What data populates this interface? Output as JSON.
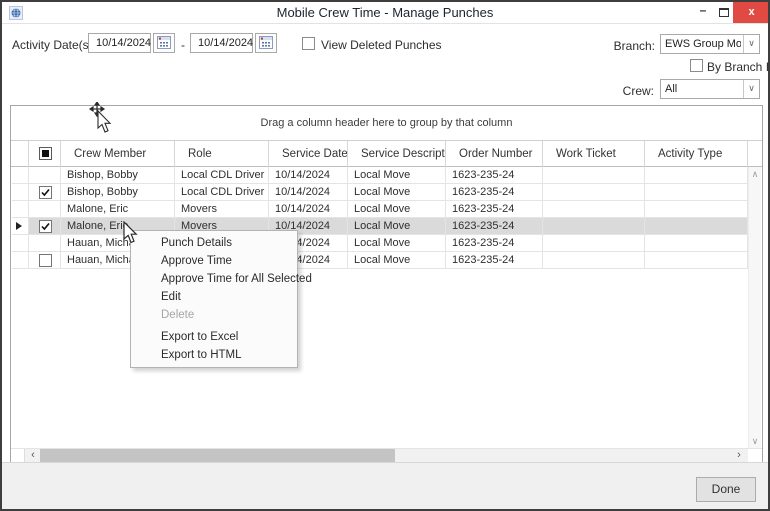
{
  "window": {
    "title": "Mobile Crew Time - Manage Punches",
    "minimize_glyph": "–",
    "close_glyph": "x"
  },
  "filters": {
    "activity_dates_label": "Activity Date(s):",
    "date_from": "10/14/2024",
    "date_range_separator": "-",
    "date_to": "10/14/2024",
    "view_deleted_label": "View Deleted Punches",
    "view_deleted_checked": false,
    "branch_label": "Branch:",
    "branch_value": "EWS Group Moving & Stor",
    "by_branch_id_label": "By Branch ID",
    "by_branch_id_checked": false,
    "crew_label": "Crew:",
    "crew_value": "All"
  },
  "grid": {
    "group_hint": "Drag a column header here to group by that column",
    "select_all_state": "indeterminate",
    "columns": [
      "Crew Member",
      "Role",
      "Service Date",
      "Service Description",
      "Order Number",
      "Work Ticket",
      "Activity Type"
    ],
    "rows": [
      {
        "checkbox": "none",
        "selected": false,
        "crew_member": "Bishop, Bobby",
        "role": "Local CDL Driver",
        "service_date": "10/14/2024",
        "service_description": "Local Move",
        "order_number": "1623-235-24",
        "work_ticket": "",
        "activity_type": ""
      },
      {
        "checkbox": "checked",
        "selected": false,
        "crew_member": "Bishop, Bobby",
        "role": "Local CDL Driver",
        "service_date": "10/14/2024",
        "service_description": "Local Move",
        "order_number": "1623-235-24",
        "work_ticket": "",
        "activity_type": ""
      },
      {
        "checkbox": "none",
        "selected": false,
        "crew_member": "Malone, Eric",
        "role": "Movers",
        "service_date": "10/14/2024",
        "service_description": "Local Move",
        "order_number": "1623-235-24",
        "work_ticket": "",
        "activity_type": ""
      },
      {
        "checkbox": "checked",
        "selected": true,
        "crew_member": "Malone, Eric",
        "role": "Movers",
        "service_date": "10/14/2024",
        "service_description": "Local Move",
        "order_number": "1623-235-24",
        "work_ticket": "",
        "activity_type": ""
      },
      {
        "checkbox": "none",
        "selected": false,
        "crew_member": "Hauan, Micha",
        "role": "",
        "service_date": "10/14/2024",
        "service_description": "Local Move",
        "order_number": "1623-235-24",
        "work_ticket": "",
        "activity_type": ""
      },
      {
        "checkbox": "unchecked",
        "selected": false,
        "crew_member": "Hauan, Micha",
        "role": "",
        "service_date": "10/14/2024",
        "service_description": "Local Move",
        "order_number": "1623-235-24",
        "work_ticket": "",
        "activity_type": ""
      }
    ]
  },
  "context_menu": {
    "items": [
      {
        "label": "Punch Details",
        "enabled": true,
        "gap": false
      },
      {
        "label": "Approve Time",
        "enabled": true,
        "gap": false
      },
      {
        "label": "Approve Time for All Selected",
        "enabled": true,
        "gap": false
      },
      {
        "label": "Edit",
        "enabled": true,
        "gap": false
      },
      {
        "label": "Delete",
        "enabled": false,
        "gap": false
      },
      {
        "label": "Export to Excel",
        "enabled": true,
        "gap": true
      },
      {
        "label": "Export to HTML",
        "enabled": true,
        "gap": false
      }
    ]
  },
  "footer": {
    "done_label": "Done"
  },
  "colors": {
    "close_button": "#e04a42",
    "selected_row": "#dadada",
    "window_border": "#3e3e3e",
    "calendar_icon_blue": "#5b79a8",
    "calendar_icon_red": "#c0392b"
  }
}
